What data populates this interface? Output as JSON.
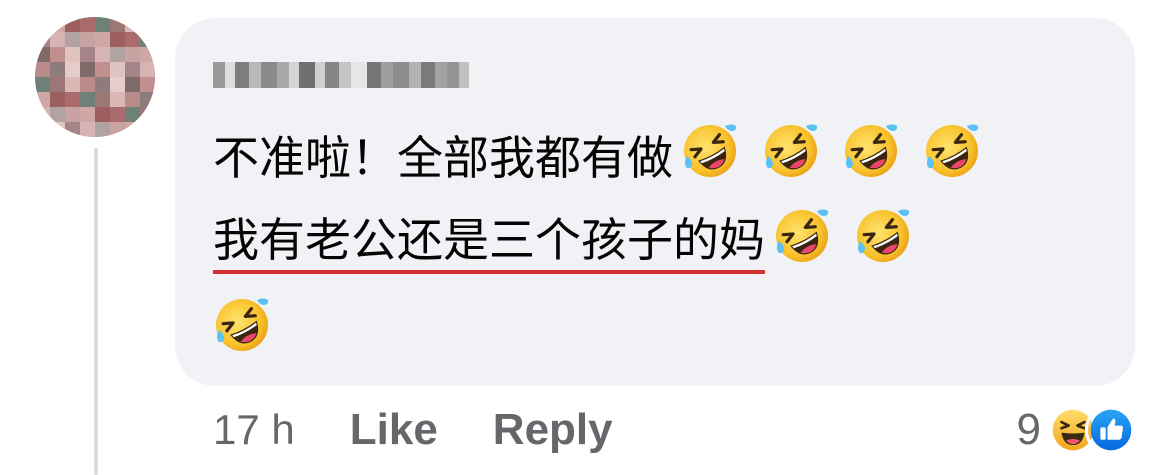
{
  "comment": {
    "author_name": "",
    "line1_text": "不准啦！全部我都有做",
    "line2_text": "我有老公还是三个孩子的妈",
    "line1_emoji_count": 4,
    "line2_emoji_count": 2,
    "line3_emoji_count": 1,
    "emoji": "rolling-on-the-floor-laughing",
    "underline_color": "#d4312e"
  },
  "meta": {
    "time": "17 h",
    "like_label": "Like",
    "reply_label": "Reply"
  },
  "reactions": {
    "count": "9",
    "icons": [
      "haha-reaction-icon",
      "like-reaction-icon"
    ]
  },
  "colors": {
    "bubble": "#f0f2f5",
    "meta_text": "#65676b",
    "like_blue": "#1877f2",
    "haha_yellow": "#f7b125"
  }
}
